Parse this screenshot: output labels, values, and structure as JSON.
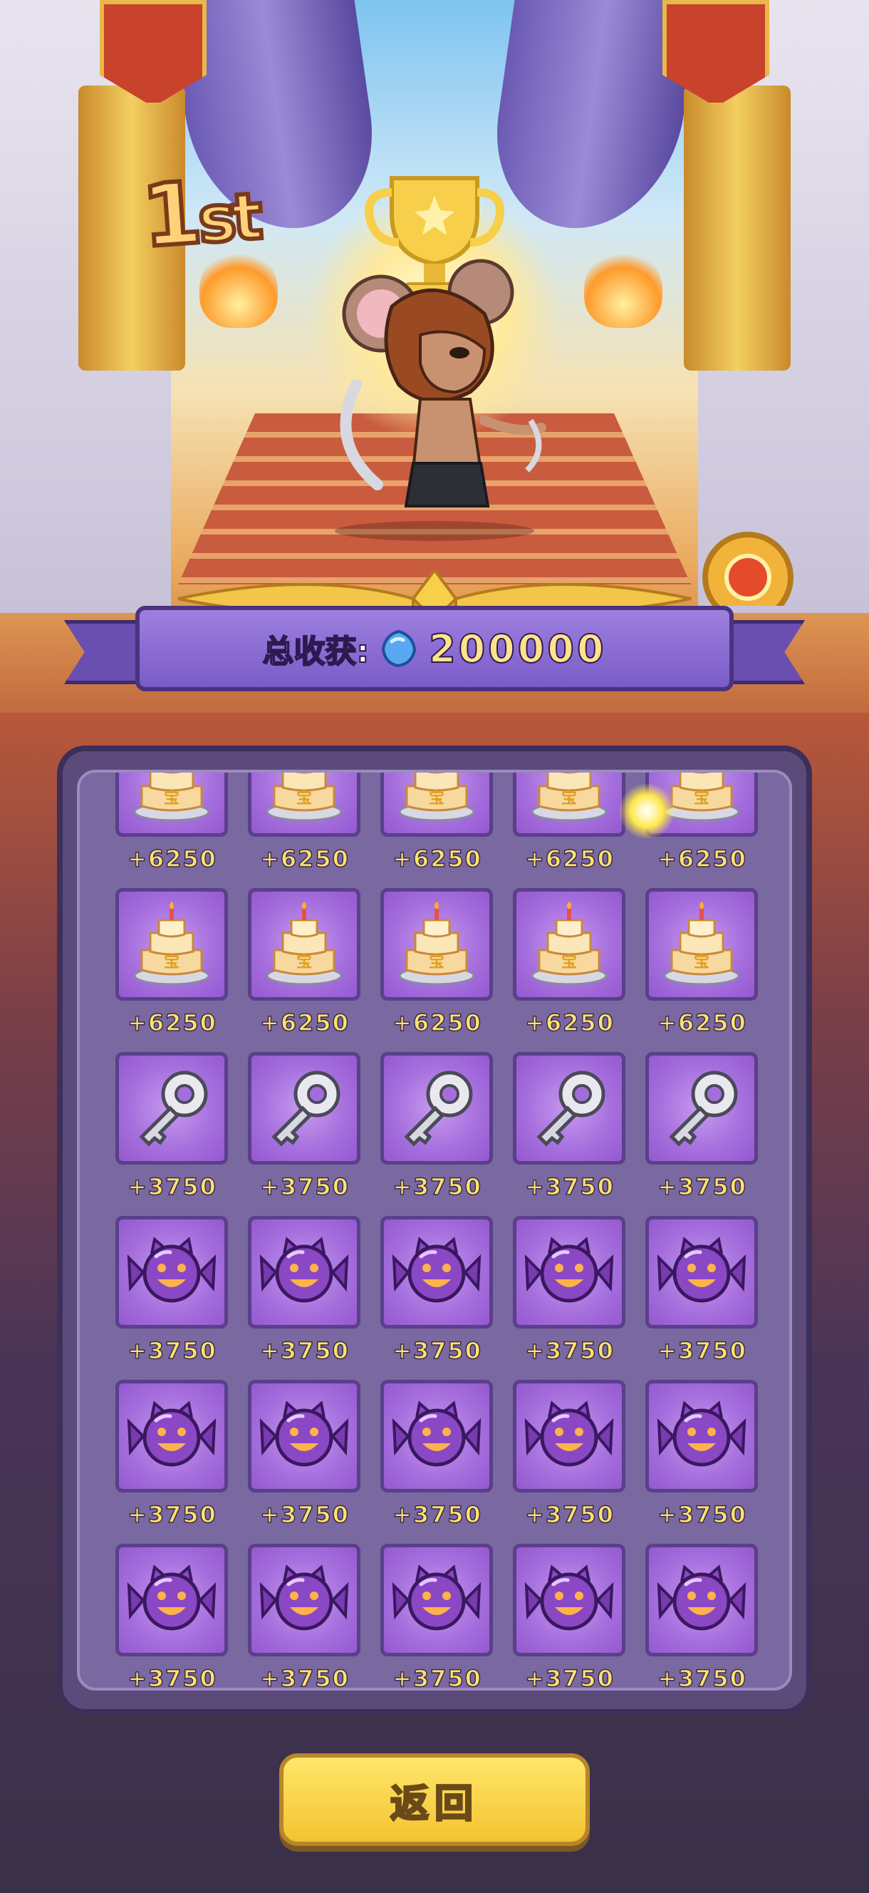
{
  "header": {
    "rank_number": "1",
    "rank_suffix": "st"
  },
  "total": {
    "label": "总收获:",
    "value": "200000",
    "currency_icon": "blue-gem-icon"
  },
  "rewards": [
    {
      "icon": "cake-icon",
      "amount": "+6250",
      "partial": true
    },
    {
      "icon": "cake-icon",
      "amount": "+6250",
      "partial": true
    },
    {
      "icon": "cake-icon",
      "amount": "+6250",
      "partial": true
    },
    {
      "icon": "cake-icon",
      "amount": "+6250",
      "partial": true
    },
    {
      "icon": "cake-icon",
      "amount": "+6250",
      "partial": true
    },
    {
      "icon": "cake-icon",
      "amount": "+6250"
    },
    {
      "icon": "cake-icon",
      "amount": "+6250"
    },
    {
      "icon": "cake-icon",
      "amount": "+6250"
    },
    {
      "icon": "cake-icon",
      "amount": "+6250"
    },
    {
      "icon": "cake-icon",
      "amount": "+6250"
    },
    {
      "icon": "key-icon",
      "amount": "+3750"
    },
    {
      "icon": "key-icon",
      "amount": "+3750"
    },
    {
      "icon": "key-icon",
      "amount": "+3750"
    },
    {
      "icon": "key-icon",
      "amount": "+3750"
    },
    {
      "icon": "key-icon",
      "amount": "+3750"
    },
    {
      "icon": "candy-icon",
      "amount": "+3750"
    },
    {
      "icon": "candy-icon",
      "amount": "+3750"
    },
    {
      "icon": "candy-icon",
      "amount": "+3750"
    },
    {
      "icon": "candy-icon",
      "amount": "+3750"
    },
    {
      "icon": "candy-icon",
      "amount": "+3750"
    },
    {
      "icon": "candy-icon",
      "amount": "+3750"
    },
    {
      "icon": "candy-icon",
      "amount": "+3750"
    },
    {
      "icon": "candy-icon",
      "amount": "+3750"
    },
    {
      "icon": "candy-icon",
      "amount": "+3750"
    },
    {
      "icon": "candy-icon",
      "amount": "+3750"
    },
    {
      "icon": "candy-icon",
      "amount": "+3750"
    },
    {
      "icon": "candy-icon",
      "amount": "+3750"
    },
    {
      "icon": "candy-icon",
      "amount": "+3750"
    },
    {
      "icon": "candy-icon",
      "amount": "+3750"
    },
    {
      "icon": "candy-icon",
      "amount": "+3750"
    }
  ],
  "buttons": {
    "return_label": "返回"
  }
}
